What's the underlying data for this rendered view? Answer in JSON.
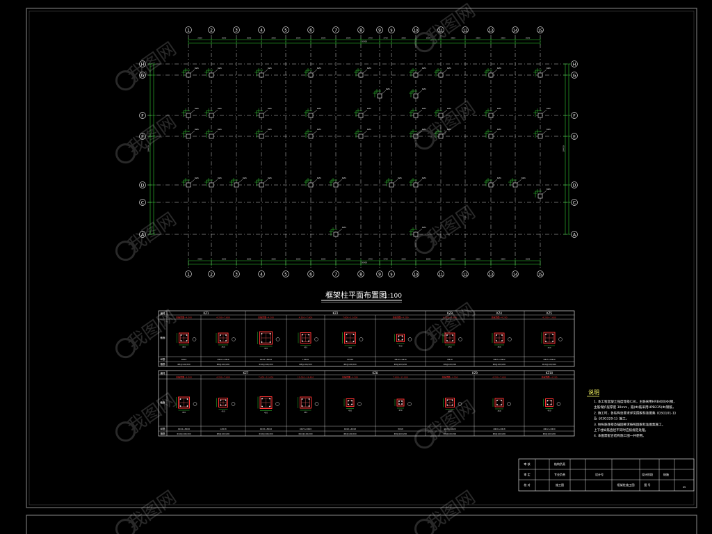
{
  "plan": {
    "title": "框架柱平面布置图",
    "scale": "1:100",
    "axis_numbers": [
      "1",
      "2",
      "3",
      "4",
      "5",
      "6",
      "7",
      "8",
      "9",
      "9",
      "10",
      "11",
      "12",
      "13",
      "14",
      "15"
    ],
    "axis_letters": [
      "H",
      "G",
      "F",
      "E",
      "D",
      "C",
      "A"
    ],
    "dim_top": [
      "2200",
      "3600",
      "3600",
      "3600",
      "3600",
      "3600",
      "3600",
      "1700",
      "1700",
      "3600",
      "3600",
      "3600",
      "3600",
      "3600",
      "3600",
      "2200"
    ],
    "dim_total": "50400",
    "dim_left": "18450",
    "column_tag": "KZ1"
  },
  "schedule": {
    "row1_groups": [
      "KZ1",
      "KZ2",
      "KZ3",
      "KZ4",
      "KZ5",
      "KZ6"
    ],
    "row2_groups": [
      "KZ7",
      "KZ8",
      "KZ9",
      "KZ10"
    ],
    "row_labels": {
      "id": "编号",
      "section": "截面",
      "edge": "纵筋",
      "stirrup": "箍筋"
    },
    "row1_elevations": [
      "基础顶面~4.200",
      "4.200~7.600",
      "基础顶面~4.200",
      "4.200~7.600",
      "7.600~11.000",
      "基础顶面~4.200",
      "4.200~7.600",
      "基础顶面~4.200",
      "4.200~7.600"
    ],
    "row2_elevations": [
      "基础顶面~4.200",
      "4.200~7.600",
      "7.600~11.000",
      "11.000~14.400",
      "基础顶面~4.200",
      "7.600~11.000",
      "基础顶面~4.200",
      "4.200~7.600",
      "基础顶面~4.200"
    ],
    "row1_bars": [
      "8Φ18",
      "4Φ20+4Φ18",
      "4Φ25+8Φ22",
      "12Φ20",
      "12Φ18",
      "4Φ20+4Φ18",
      "8Φ18",
      "4Φ25+4Φ22",
      "4Φ25+8Φ20"
    ],
    "row2_bars": [
      "4Φ22+8Φ20",
      "12Φ18",
      "4Φ25+8Φ22",
      "4Φ25+8Φ20",
      "4Φ20+4Φ18",
      "8Φ18",
      "4Φ22+4Φ20",
      "4Φ20+4Φ18",
      "4Φ22+4Φ20"
    ],
    "row1_stirrups": [
      "Φ8@100/200",
      "Φ8@100/200",
      "Φ10@100/200",
      "Φ8@100/200",
      "Φ8@100/200",
      "Φ8@100/200",
      "Φ8@100/200",
      "Φ8@100/200",
      "Φ10@100/200"
    ],
    "row2_stirrups": [
      "Φ10@100/200",
      "Φ8@100/200",
      "Φ10@100/200",
      "Φ10@100/200",
      "Φ8@100/200",
      "Φ8@100/200",
      "Φ8@100/200",
      "Φ8@100/200",
      "Φ8@100/200"
    ],
    "dim_label": "450"
  },
  "notes": {
    "heading": "说明",
    "items": [
      "1. 本工程混凝土强度等级C30，主筋采用HRB400(Φ)钢，",
      "   主筋保护层厚度 30mm，箍(Φ)筋采用HPB235(Φ)钢筋，",
      "2. 施工时，各柱构造要求详见国家标准图集《03G101-1》",
      "   及《03G329-1》施工。",
      "3. 柱纵筋连接及锚固要求按照国家标准图集施工，",
      "   上下柱纵筋直径不同时应按规定处理。",
      "4. 本图需配合结构施工图一并使用。"
    ]
  },
  "title_block": {
    "cells": [
      "审 核",
      "结构负责",
      "设计号",
      "审 定",
      "专业负责",
      "设计阶段",
      "校 对",
      "施工图",
      "图 号"
    ],
    "drawing_name": "框架柱施工图",
    "sheet_label": "结施",
    "page": "05"
  },
  "watermark": "我图网"
}
